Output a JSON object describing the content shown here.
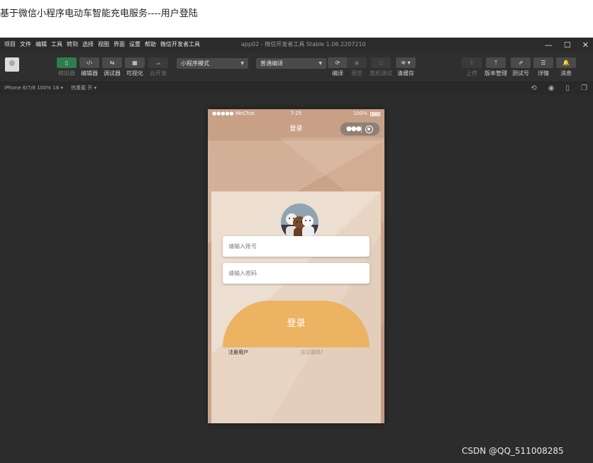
{
  "article": {
    "title": "基于微信小程序电动车智能充电服务----用户登陆"
  },
  "ide": {
    "menu": [
      "项目",
      "文件",
      "编辑",
      "工具",
      "转到",
      "选择",
      "视图",
      "界面",
      "设置",
      "帮助",
      "微信开发者工具"
    ],
    "window_title": "app02 - 微信开发者工具 Stable 1.06.2207210",
    "window_controls": {
      "minimize": "—",
      "maximize": "☐",
      "close": "✕"
    },
    "toolbar": {
      "left_buttons": [
        {
          "label": "模拟器",
          "icon": "▯"
        },
        {
          "label": "编辑器",
          "icon": "‹/›"
        },
        {
          "label": "调试器",
          "icon": "⇆"
        },
        {
          "label": "可视化",
          "icon": "▦"
        },
        {
          "label": "云开发",
          "icon": "☁"
        }
      ],
      "mode_select": "小程序模式",
      "compile_select": "普通编译",
      "mid_buttons": [
        {
          "label": "编译",
          "icon": "⟳"
        },
        {
          "label": "预览",
          "icon": "◉"
        },
        {
          "label": "真机调试",
          "icon": "⬡"
        },
        {
          "label": "清缓存",
          "icon": "≋ ▾"
        }
      ],
      "right_buttons": [
        {
          "label": "上传",
          "icon": "⇪"
        },
        {
          "label": "版本管理",
          "icon": "ᛘ"
        },
        {
          "label": "测试号",
          "icon": "⇗"
        },
        {
          "label": "详情",
          "icon": "☰"
        },
        {
          "label": "消息",
          "icon": "🔔"
        }
      ]
    },
    "device_bar": {
      "model": "iPhone 6/7/8 100% 16 ▾",
      "hot_reload": "热重载 开 ▾"
    }
  },
  "phone": {
    "status": {
      "carrier": "●●●●● WeChat",
      "time": "7:25",
      "battery": "100%"
    },
    "nav_title": "登录",
    "capsule": {
      "menu": "●●●",
      "close": "◎"
    },
    "login": {
      "account_placeholder": "请输入账号",
      "password_placeholder": "请输入密码",
      "submit": "登录",
      "register": "注册用户",
      "forgot": "忘记密码?"
    }
  },
  "watermark": "CSDN @QQ_511008285",
  "colors": {
    "accent": "#ecb362",
    "phone_bg": "#caa38a",
    "ide_bg": "#2c2c2c"
  }
}
